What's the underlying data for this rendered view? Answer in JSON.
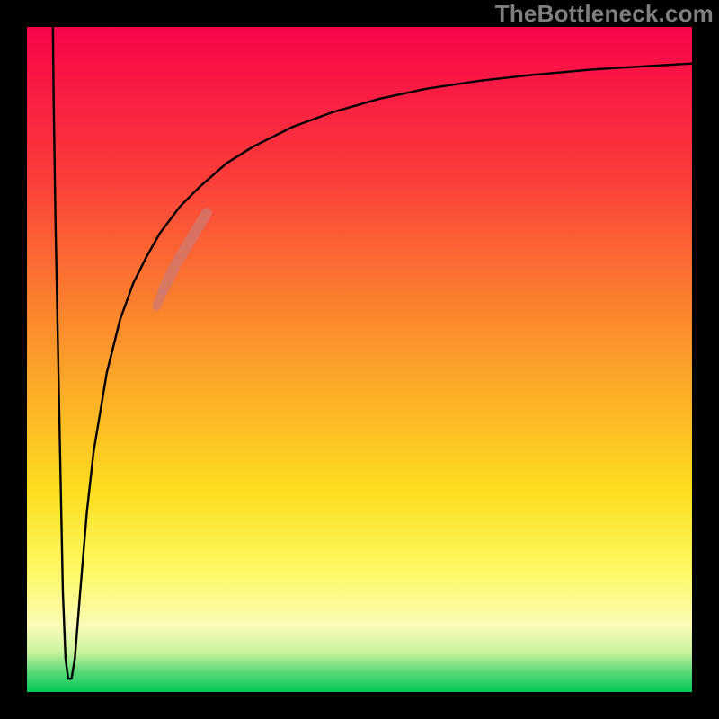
{
  "watermark": "TheBottleneck.com",
  "chart_data": {
    "type": "line",
    "title": "",
    "xlabel": "",
    "ylabel": "",
    "xlim": [
      0,
      100
    ],
    "ylim": [
      0,
      100
    ],
    "gradient_stops": [
      {
        "offset": 0.0,
        "color": "#f8044a"
      },
      {
        "offset": 0.22,
        "color": "#fb3b3a"
      },
      {
        "offset": 0.45,
        "color": "#fb8c2c"
      },
      {
        "offset": 0.7,
        "color": "#fcde1f"
      },
      {
        "offset": 0.82,
        "color": "#fdf965"
      },
      {
        "offset": 0.9,
        "color": "#fbfbb7"
      },
      {
        "offset": 0.94,
        "color": "#c9f39d"
      },
      {
        "offset": 0.97,
        "color": "#5ad979"
      },
      {
        "offset": 1.0,
        "color": "#00c853"
      }
    ],
    "frame_thickness_px": 30,
    "series": [
      {
        "name": "bottleneck-curve",
        "color": "#000000",
        "stroke_width": 2.4,
        "points": [
          {
            "x": 3.9,
            "y": 100.0
          },
          {
            "x": 4.0,
            "y": 90.0
          },
          {
            "x": 4.3,
            "y": 70.0
          },
          {
            "x": 4.7,
            "y": 50.0
          },
          {
            "x": 5.1,
            "y": 30.0
          },
          {
            "x": 5.4,
            "y": 15.0
          },
          {
            "x": 5.8,
            "y": 5.0
          },
          {
            "x": 6.2,
            "y": 2.0
          },
          {
            "x": 6.7,
            "y": 2.0
          },
          {
            "x": 7.2,
            "y": 5.0
          },
          {
            "x": 8.0,
            "y": 15.0
          },
          {
            "x": 9.0,
            "y": 27.0
          },
          {
            "x": 10.0,
            "y": 36.0
          },
          {
            "x": 12.0,
            "y": 48.0
          },
          {
            "x": 14.0,
            "y": 56.0
          },
          {
            "x": 16.0,
            "y": 61.5
          },
          {
            "x": 18.0,
            "y": 65.5
          },
          {
            "x": 20.0,
            "y": 69.0
          },
          {
            "x": 23.0,
            "y": 73.0
          },
          {
            "x": 26.0,
            "y": 76.0
          },
          {
            "x": 30.0,
            "y": 79.5
          },
          {
            "x": 34.0,
            "y": 82.0
          },
          {
            "x": 40.0,
            "y": 85.0
          },
          {
            "x": 46.0,
            "y": 87.2
          },
          {
            "x": 53.0,
            "y": 89.2
          },
          {
            "x": 60.0,
            "y": 90.7
          },
          {
            "x": 68.0,
            "y": 91.9
          },
          {
            "x": 76.0,
            "y": 92.8
          },
          {
            "x": 85.0,
            "y": 93.6
          },
          {
            "x": 93.0,
            "y": 94.1
          },
          {
            "x": 100.0,
            "y": 94.5
          }
        ]
      },
      {
        "name": "highlight-band",
        "color": "#cf786f",
        "stroke_width": 12,
        "opacity": 0.78,
        "points": [
          {
            "x": 20.5,
            "y": 60.5
          },
          {
            "x": 22.5,
            "y": 64.5
          },
          {
            "x": 24.0,
            "y": 67.0
          },
          {
            "x": 25.5,
            "y": 69.5
          },
          {
            "x": 27.0,
            "y": 72.0
          }
        ]
      },
      {
        "name": "highlight-dot-lower",
        "color": "#cf786f",
        "stroke_width": 10,
        "opacity": 0.78,
        "points": [
          {
            "x": 19.5,
            "y": 58.0
          },
          {
            "x": 20.3,
            "y": 60.0
          }
        ]
      }
    ]
  }
}
